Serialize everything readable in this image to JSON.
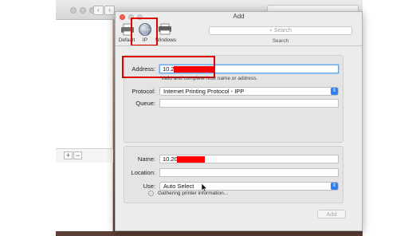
{
  "background_window": {
    "nav_back": "‹",
    "nav_forward": "›",
    "add_button": "+",
    "remove_button": "−"
  },
  "dialog": {
    "title": "Add",
    "toolbar": {
      "tabs": [
        {
          "label": "Default",
          "icon": "printer-icon"
        },
        {
          "label": "IP",
          "icon": "globe-icon"
        },
        {
          "label": "Windows",
          "icon": "windows-printer-icon"
        }
      ],
      "search_placeholder": "Search",
      "search_caption": "Search"
    },
    "address": {
      "label": "Address:",
      "value": "10.2",
      "hint": "Valid and complete host name or address."
    },
    "protocol": {
      "label": "Protocol:",
      "value": "Internet Printing Protocol - IPP"
    },
    "queue": {
      "label": "Queue:",
      "value": ""
    },
    "name": {
      "label": "Name:",
      "value": "10.20"
    },
    "location": {
      "label": "Location:",
      "value": ""
    },
    "use": {
      "label": "Use:",
      "value": "Auto Select"
    },
    "status_text": "Gathering printer information...",
    "add_button_label": "Add"
  },
  "colors": {
    "highlight_red": "#e00000",
    "accent_blue": "#2f7ff5",
    "redaction": "#ff0000"
  }
}
